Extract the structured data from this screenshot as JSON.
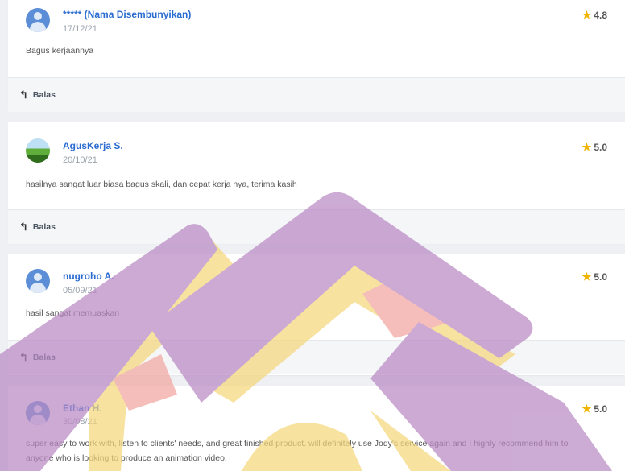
{
  "reply_label": "Balas",
  "reviews": [
    {
      "name": "***** (Nama Disembunyikan)",
      "date": "17/12/21",
      "rating": "4.8",
      "comment": "Bagus kerjaannya",
      "avatar": "default-avatar"
    },
    {
      "name": "AgusKerja S.",
      "date": "20/10/21",
      "rating": "5.0",
      "comment": "hasilnya sangat luar biasa bagus skali, dan cepat kerja nya, terima kasih",
      "avatar": "photo-avatar"
    },
    {
      "name": "nugroho A.",
      "date": "05/09/21",
      "rating": "5.0",
      "comment": "hasil sangat memuaskan",
      "avatar": "default-avatar"
    },
    {
      "name": "Ethan H.",
      "date": "30/08/21",
      "rating": "5.0",
      "comment": "super easy to work with, listen to clients' needs, and great finished product. will definitely use Jody's service again and I highly recommend him to anyone who is looking to produce an animation video.",
      "avatar": "default-avatar"
    }
  ],
  "colors": {
    "accent_link": "#2b6cd1",
    "star": "#f0b400",
    "watermark_purple": "#b98ac4",
    "watermark_yellow": "#f4d77c"
  }
}
